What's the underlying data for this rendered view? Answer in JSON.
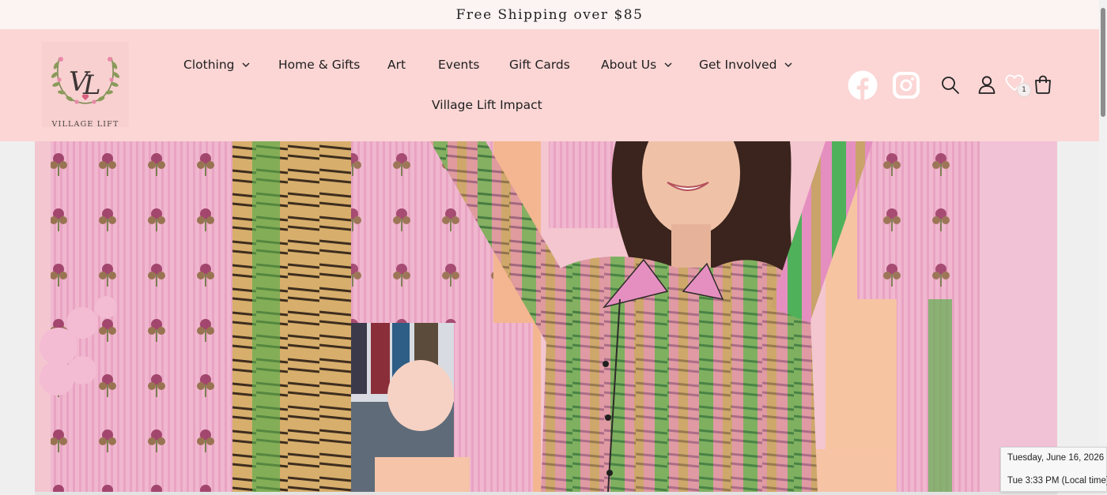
{
  "announcement": {
    "text": "Free Shipping over $85"
  },
  "brand": {
    "monogram": "VL",
    "name": "VILLAGE LIFT"
  },
  "nav": {
    "items": [
      {
        "label": "Clothing",
        "dropdown": true
      },
      {
        "label": "Home & Gifts",
        "dropdown": false
      },
      {
        "label": "Art",
        "dropdown": false
      },
      {
        "label": "Events",
        "dropdown": false
      },
      {
        "label": "Gift Cards",
        "dropdown": false
      },
      {
        "label": "About Us",
        "dropdown": true
      },
      {
        "label": "Get Involved",
        "dropdown": true
      },
      {
        "label": "Village Lift Impact",
        "dropdown": false
      }
    ]
  },
  "header_icons": {
    "social": [
      "facebook-icon",
      "instagram-icon"
    ],
    "utility": [
      "search-icon",
      "account-icon",
      "wishlist-heart-icon",
      "cart-icon"
    ],
    "wishlist_count": "1"
  },
  "hero": {
    "image": "woman-in-pink-green-tiger-print-pajamas-between-block-print-curtains"
  },
  "taskbar_clock": {
    "date": "Tuesday, June 16, 2026",
    "time": "Tue 3:33 PM (Local time)"
  },
  "colors": {
    "header_bg": "#fbd6d5",
    "announcement_bg": "#fbf4f2",
    "page_bg": "#efefef"
  }
}
